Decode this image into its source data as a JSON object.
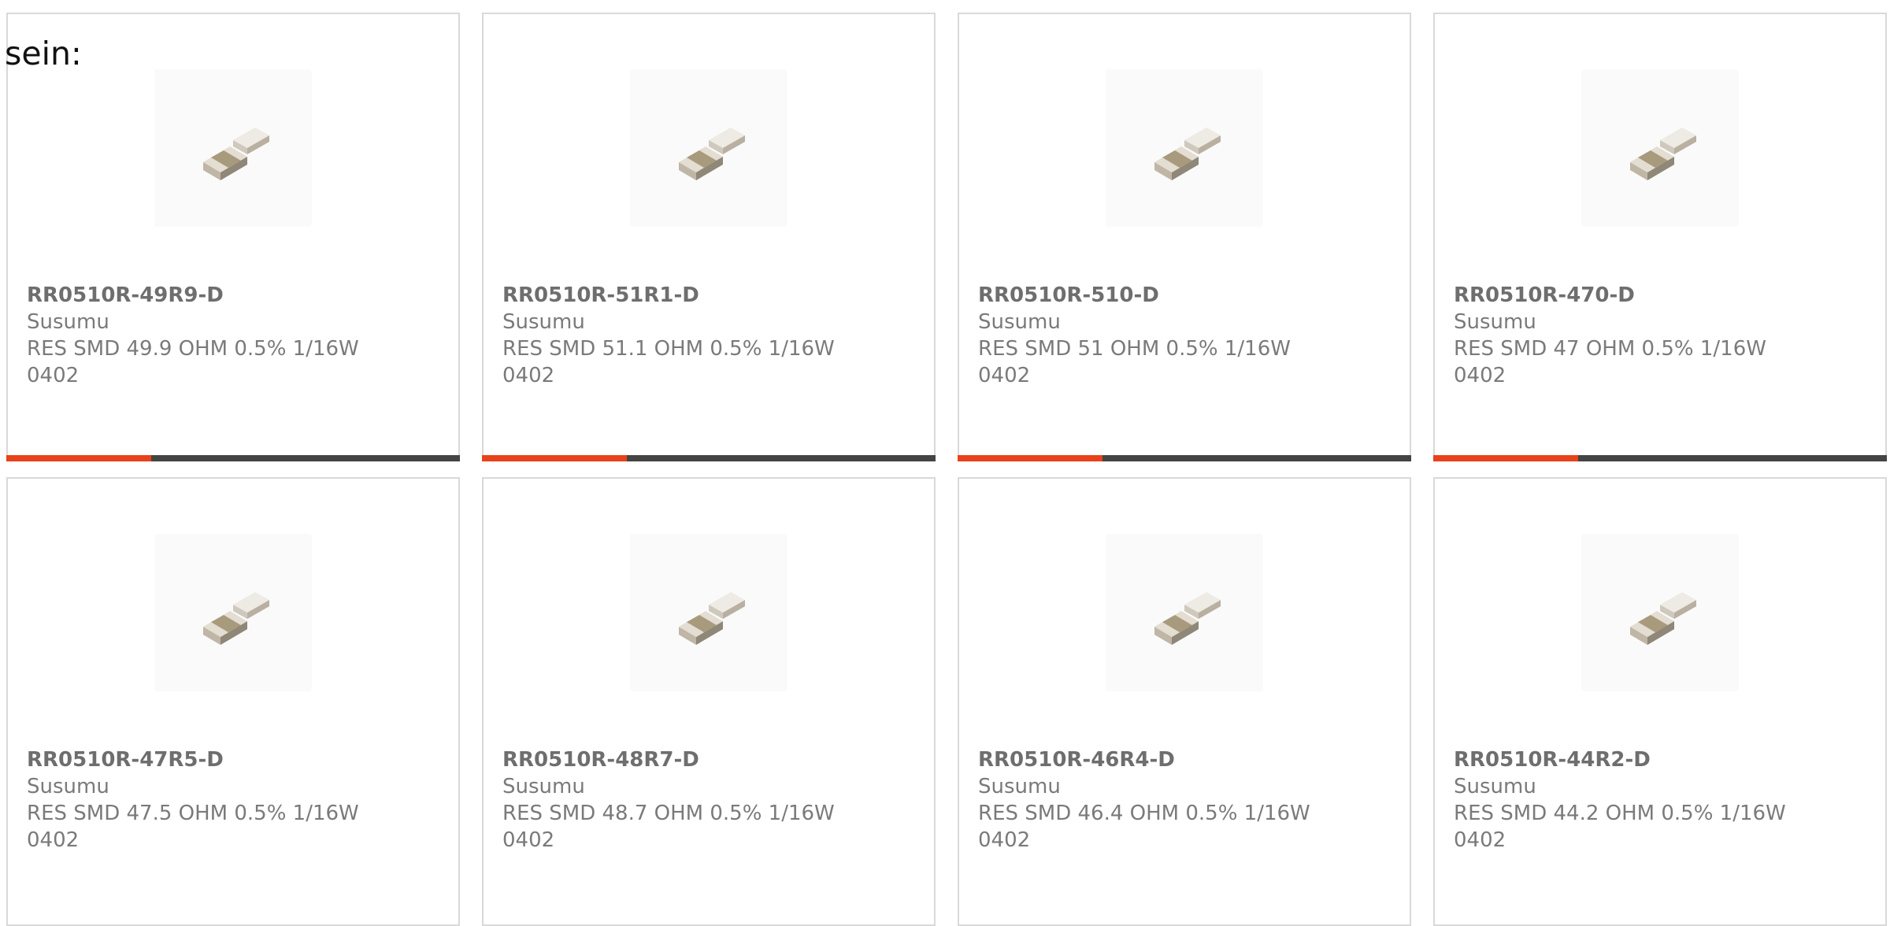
{
  "intro_text": "sein:",
  "colors": {
    "accent": "#e8421a",
    "bar_track": "#444444",
    "card_border": "#d9d9d9",
    "text": "#777777"
  },
  "product_icon": "smd-resistor-image",
  "progress_fraction": 0.32,
  "products": [
    {
      "part_number": "RR0510R-49R9-D",
      "manufacturer": "Susumu",
      "description": "RES SMD 49.9 OHM 0.5% 1/16W 0402"
    },
    {
      "part_number": "RR0510R-51R1-D",
      "manufacturer": "Susumu",
      "description": "RES SMD 51.1 OHM 0.5% 1/16W 0402"
    },
    {
      "part_number": "RR0510R-510-D",
      "manufacturer": "Susumu",
      "description": "RES SMD 51 OHM 0.5% 1/16W 0402"
    },
    {
      "part_number": "RR0510R-470-D",
      "manufacturer": "Susumu",
      "description": "RES SMD 47 OHM 0.5% 1/16W 0402"
    },
    {
      "part_number": "RR0510R-47R5-D",
      "manufacturer": "Susumu",
      "description": "RES SMD 47.5 OHM 0.5% 1/16W 0402"
    },
    {
      "part_number": "RR0510R-48R7-D",
      "manufacturer": "Susumu",
      "description": "RES SMD 48.7 OHM 0.5% 1/16W 0402"
    },
    {
      "part_number": "RR0510R-46R4-D",
      "manufacturer": "Susumu",
      "description": "RES SMD 46.4 OHM 0.5% 1/16W 0402"
    },
    {
      "part_number": "RR0510R-44R2-D",
      "manufacturer": "Susumu",
      "description": "RES SMD 44.2 OHM 0.5% 1/16W 0402"
    }
  ]
}
